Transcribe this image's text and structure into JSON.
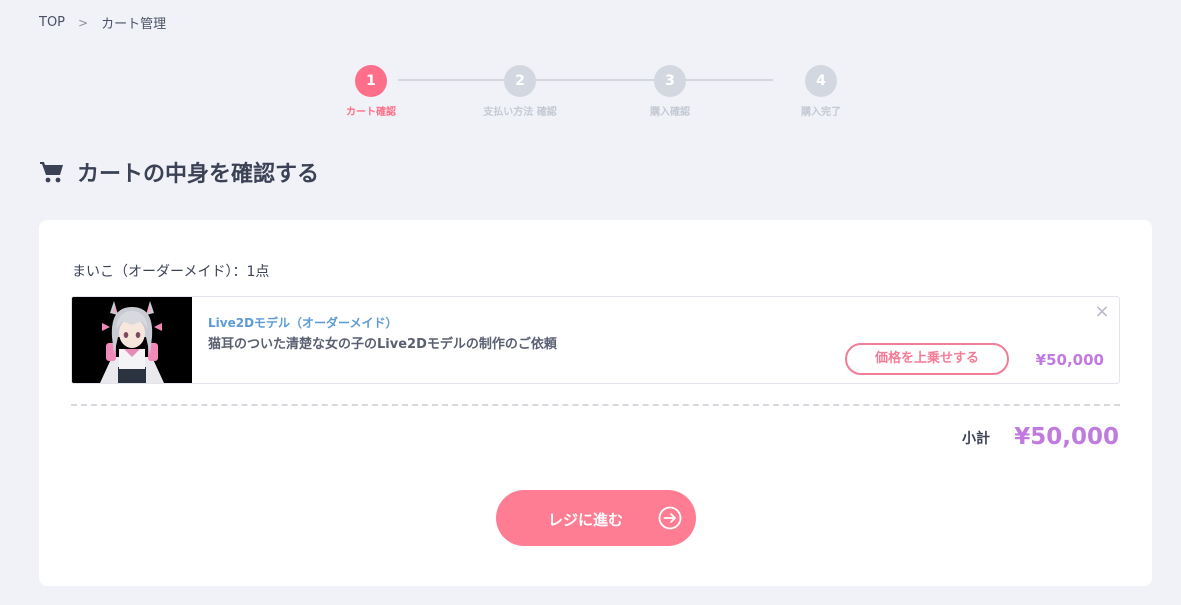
{
  "breadcrumb": {
    "home": "TOP",
    "current": "カート管理"
  },
  "steps": [
    {
      "num": "1",
      "label": "カート確認"
    },
    {
      "num": "2",
      "label": "支払い方法 確認"
    },
    {
      "num": "3",
      "label": "購入確認"
    },
    {
      "num": "4",
      "label": "購入完了"
    }
  ],
  "page_title": "カートの中身を確認する",
  "cart": {
    "seller": "まいこ（オーダーメイド）：1点",
    "item": {
      "type": "Live2Dモデル（オーダーメイド）",
      "name": "猫耳のついた清楚な女の子のLive2Dモデルの制作のご依頼",
      "upsell_label": "価格を上乗せする",
      "price": "¥50,000",
      "remove_label": "×"
    },
    "subtotal_label": "小計",
    "subtotal_value": "¥50,000",
    "checkout_label": "レジに進む"
  },
  "colors": {
    "accent": "#ff6f8a",
    "price": "#c17ae0",
    "link": "#5c9bd6"
  }
}
